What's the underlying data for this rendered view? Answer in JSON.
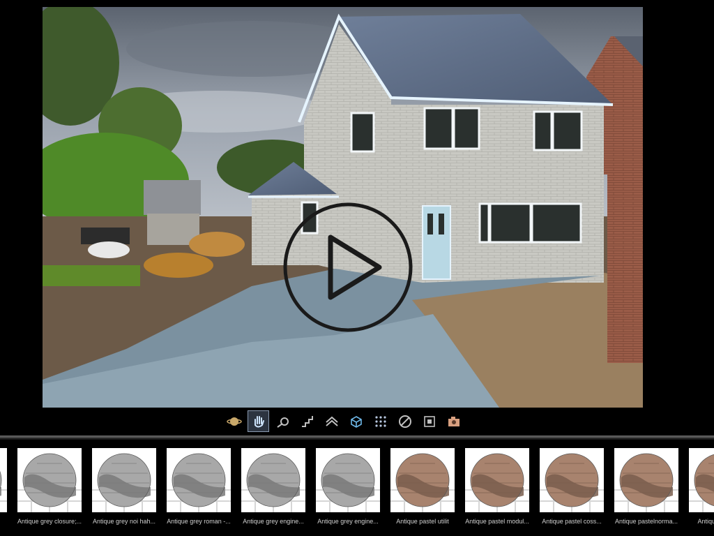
{
  "viewport": {
    "play_label": "Play"
  },
  "toolbar": {
    "tools": [
      {
        "name": "planet-icon",
        "label": "Environment"
      },
      {
        "name": "hand-icon",
        "label": "Navigate",
        "active": true
      },
      {
        "name": "comet-icon",
        "label": "Fly"
      },
      {
        "name": "stairs-icon",
        "label": "Walk"
      },
      {
        "name": "roof-icon",
        "label": "Roof"
      },
      {
        "name": "cube-select-icon",
        "label": "Select"
      },
      {
        "name": "grid-dots-icon",
        "label": "Texture"
      },
      {
        "name": "no-entry-icon",
        "label": "Hide"
      },
      {
        "name": "frame-icon",
        "label": "Frame"
      },
      {
        "name": "camera-icon",
        "label": "Snapshot"
      }
    ]
  },
  "materials": [
    {
      "label": "Antique grey closure;...",
      "color": "grey"
    },
    {
      "label": "Antique grey noi hah...",
      "color": "grey"
    },
    {
      "label": "Antique grey roman -...",
      "color": "grey"
    },
    {
      "label": "Antique grey engine...",
      "color": "grey"
    },
    {
      "label": "Antique grey engine...",
      "color": "grey"
    },
    {
      "label": "Antique pastel utilit",
      "color": "pastel"
    },
    {
      "label": "Antique pastel modul...",
      "color": "pastel"
    },
    {
      "label": "Antique pastel coss...",
      "color": "pastel"
    },
    {
      "label": "Antique pastelnorma...",
      "color": "pastel"
    },
    {
      "label": "Antique pastel ...",
      "color": "pastel"
    }
  ],
  "colors": {
    "grey_sphere": "#a8a8a8",
    "pastel_sphere": "#a8836e",
    "active_tool": "#2c3440"
  }
}
